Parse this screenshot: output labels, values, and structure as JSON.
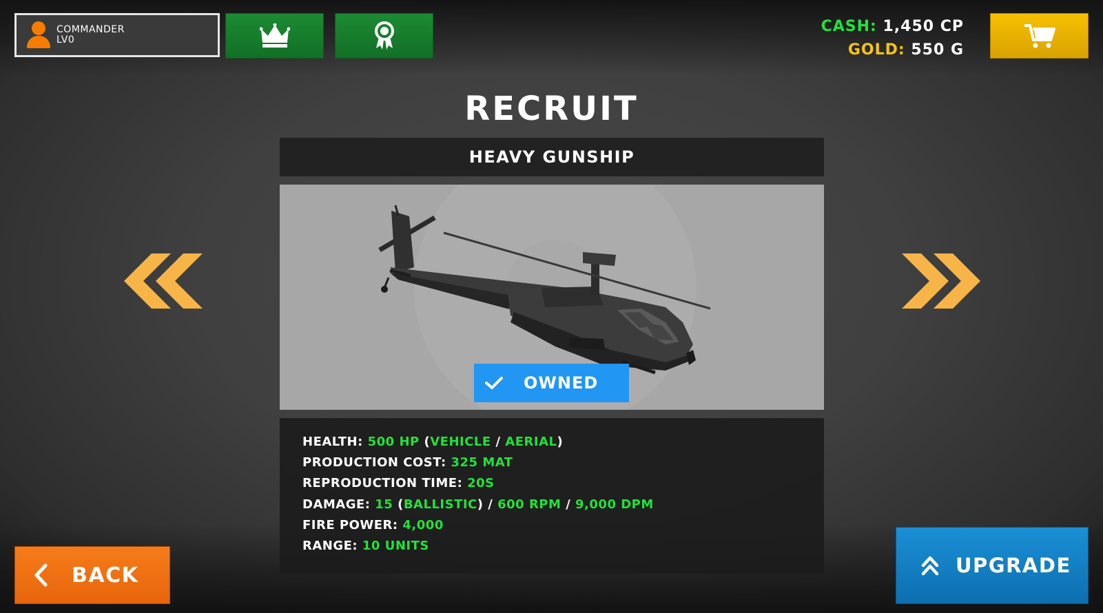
{
  "profile": {
    "name": "COMMANDER",
    "level": "LV0"
  },
  "top_buttons": [
    {
      "icon": "crown-icon"
    },
    {
      "icon": "ribbon-award-icon"
    }
  ],
  "currency": {
    "cash_label": "CASH:",
    "cash_value": "1,450 CP",
    "gold_label": "GOLD:",
    "gold_value": "550 G"
  },
  "shop": {
    "icon": "cart-icon"
  },
  "title": "RECRUIT",
  "unit": {
    "name": "HEAVY GUNSHIP",
    "status": "OWNED",
    "image": "helicopter-gunship"
  },
  "stats": {
    "health_label": "HEALTH:",
    "health_value": "500 HP",
    "health_type1": "VEHICLE",
    "health_type2": "AERIAL",
    "cost_label": "PRODUCTION COST:",
    "cost_value": "325 MAT",
    "time_label": "REPRODUCTION TIME:",
    "time_value": "20S",
    "damage_label": "DAMAGE:",
    "damage_value": "15",
    "damage_type": "BALLISTIC",
    "damage_rpm": "600 RPM",
    "damage_dpm": "9,000 DPM",
    "firepower_label": "FIRE POWER:",
    "firepower_value": "4,000",
    "range_label": "RANGE:",
    "range_value": "10 UNITS"
  },
  "buttons": {
    "back": "BACK",
    "upgrade": "UPGRADE"
  },
  "colors": {
    "accent_green": "#22e23a",
    "gold": "#f5c518",
    "orange": "#f57c1a",
    "blue": "#2196f3",
    "chevron": "#f7b548"
  }
}
